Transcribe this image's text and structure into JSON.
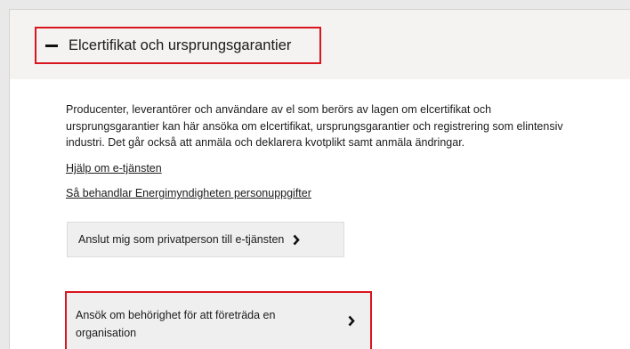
{
  "accordion": {
    "title": "Elcertifikat och ursprungsgarantier",
    "toggle_icon": "minus-icon",
    "state": "expanded"
  },
  "intro": {
    "lines": [
      "Producenter, leverantörer och användare av el som berörs av lagen om elcertifikat och",
      "ursprungsgarantier kan här ansöka om elcertifikat, ursprungsgarantier och registrering som elintensiv",
      "industri. Det går också att anmäla och deklarera kvotplikt samt anmäla ändringar."
    ]
  },
  "links": {
    "help": "Hjälp om e-tjänsten",
    "privacy": "Så behandlar Energimyndigheten personuppgifter"
  },
  "buttons": {
    "private_person": "Anslut mig som privatperson till e-tjänsten",
    "organisation": "Ansök om behörighet för att företräda en organisation"
  },
  "icons": {
    "button_arrow": "chevron-right-icon"
  },
  "colors": {
    "highlight": "#d9151f",
    "header_bg": "#f4f3f2",
    "button_bg": "#efefef"
  }
}
